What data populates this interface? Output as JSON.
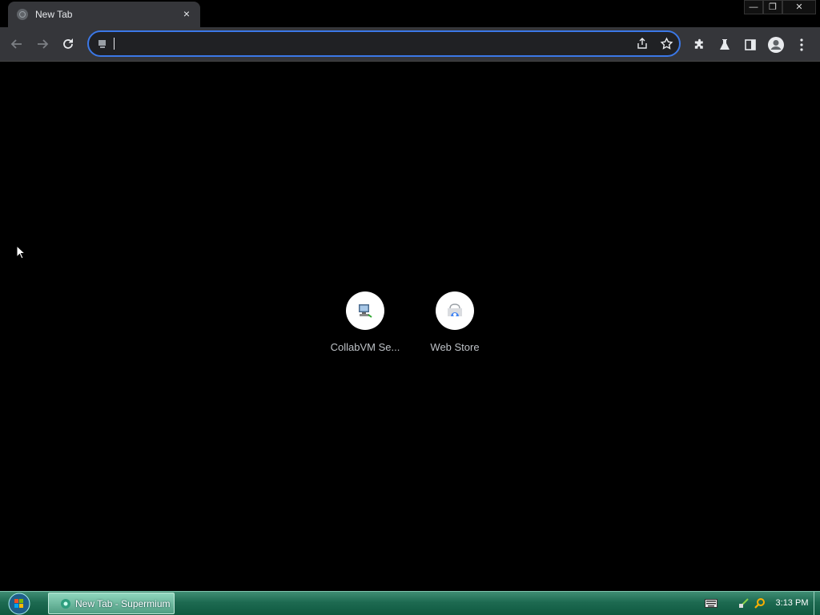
{
  "window": {
    "tab_title": "New Tab",
    "tab_close_glyph": "×",
    "controls": {
      "minimize": "—",
      "maximize": "❐",
      "close": "✕"
    }
  },
  "toolbar": {
    "omnibox_value": "",
    "icons": [
      "back-arrow-icon",
      "forward-arrow-icon",
      "reload-icon",
      "share-icon",
      "star-icon",
      "extensions-icon",
      "labs-flask-icon",
      "side-panel-icon",
      "profile-avatar-icon",
      "kebab-menu-icon"
    ]
  },
  "ntp": {
    "shortcuts": [
      {
        "label": "CollabVM Se...",
        "icon": "computer-icon"
      },
      {
        "label": "Web Store",
        "icon": "web-store-icon"
      }
    ]
  },
  "taskbar": {
    "task_label": "New Tab - Supermium",
    "clock": "3:13 PM"
  },
  "colors": {
    "page_bg": "#000000",
    "toolbar_bg": "#35363a",
    "omnibox_focus": "#3b78e7",
    "taskbar": "#1d6a51"
  }
}
